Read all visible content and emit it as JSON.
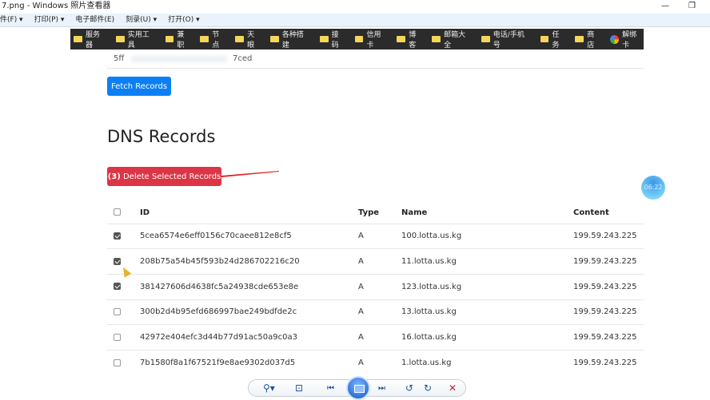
{
  "window": {
    "title": "7.png - Windows 照片查看器",
    "minimize": "—",
    "restore": "❐"
  },
  "menu": [
    "件(F) ▾",
    "打印(P) ▾",
    "电子邮件(E)",
    "刻录(U) ▾",
    "打开(O) ▾"
  ],
  "bookmarks": [
    {
      "label": "服务器",
      "icon": "folder-icon"
    },
    {
      "label": "实用工具",
      "icon": "folder-icon"
    },
    {
      "label": "兼职",
      "icon": "folder-icon"
    },
    {
      "label": "节点",
      "icon": "folder-icon"
    },
    {
      "label": "天眼",
      "icon": "folder-icon"
    },
    {
      "label": "各种搭建",
      "icon": "folder-icon"
    },
    {
      "label": "接码",
      "icon": "folder-icon"
    },
    {
      "label": "信用卡",
      "icon": "folder-icon"
    },
    {
      "label": "博客",
      "icon": "folder-icon"
    },
    {
      "label": "邮箱大全",
      "icon": "folder-icon"
    },
    {
      "label": "电话/手机号",
      "icon": "folder-icon"
    },
    {
      "label": "任务",
      "icon": "folder-icon"
    },
    {
      "label": "商店",
      "icon": "folder-icon"
    },
    {
      "label": "解绑卡",
      "icon": "google-icon"
    }
  ],
  "key_field": {
    "start": "5ff",
    "end": "7ced"
  },
  "fetch_label": "Fetch Records",
  "heading": "DNS Records",
  "delete_button": {
    "count": "(3)",
    "label": " Delete Selected Records",
    "color": "#dc3545"
  },
  "table": {
    "headers": [
      "ID",
      "Type",
      "Name",
      "Content"
    ],
    "rows": [
      {
        "checked": true,
        "id": "5cea6574e6eff0156c70caee812e8cf5",
        "type": "A",
        "name": "100.lotta.us.kg",
        "content": "199.59.243.225"
      },
      {
        "checked": true,
        "id": "208b75a54b45f593b24d286702216c20",
        "type": "A",
        "name": "11.lotta.us.kg",
        "content": "199.59.243.225"
      },
      {
        "checked": true,
        "id": "381427606d4638fc5a24938cde653e8e",
        "type": "A",
        "name": "123.lotta.us.kg",
        "content": "199.59.243.225"
      },
      {
        "checked": false,
        "id": "300b2d4b95efd686997bae249bdfde2c",
        "type": "A",
        "name": "13.lotta.us.kg",
        "content": "199.59.243.225"
      },
      {
        "checked": false,
        "id": "42972e404efc3d44b77d91ac50a9c0a3",
        "type": "A",
        "name": "16.lotta.us.kg",
        "content": "199.59.243.225"
      },
      {
        "checked": false,
        "id": "7b1580f8a1f67521f9e8ae9302d037d5",
        "type": "A",
        "name": "1.lotta.us.kg",
        "content": "199.59.243.225"
      }
    ]
  },
  "clock": "06:22",
  "viewer_toolbar": {
    "zoom": "⚲▾",
    "fit": "⊡",
    "prev": "⏮",
    "next": "⏭",
    "rotate_left": "↺",
    "rotate_right": "↻",
    "delete": "✕"
  }
}
